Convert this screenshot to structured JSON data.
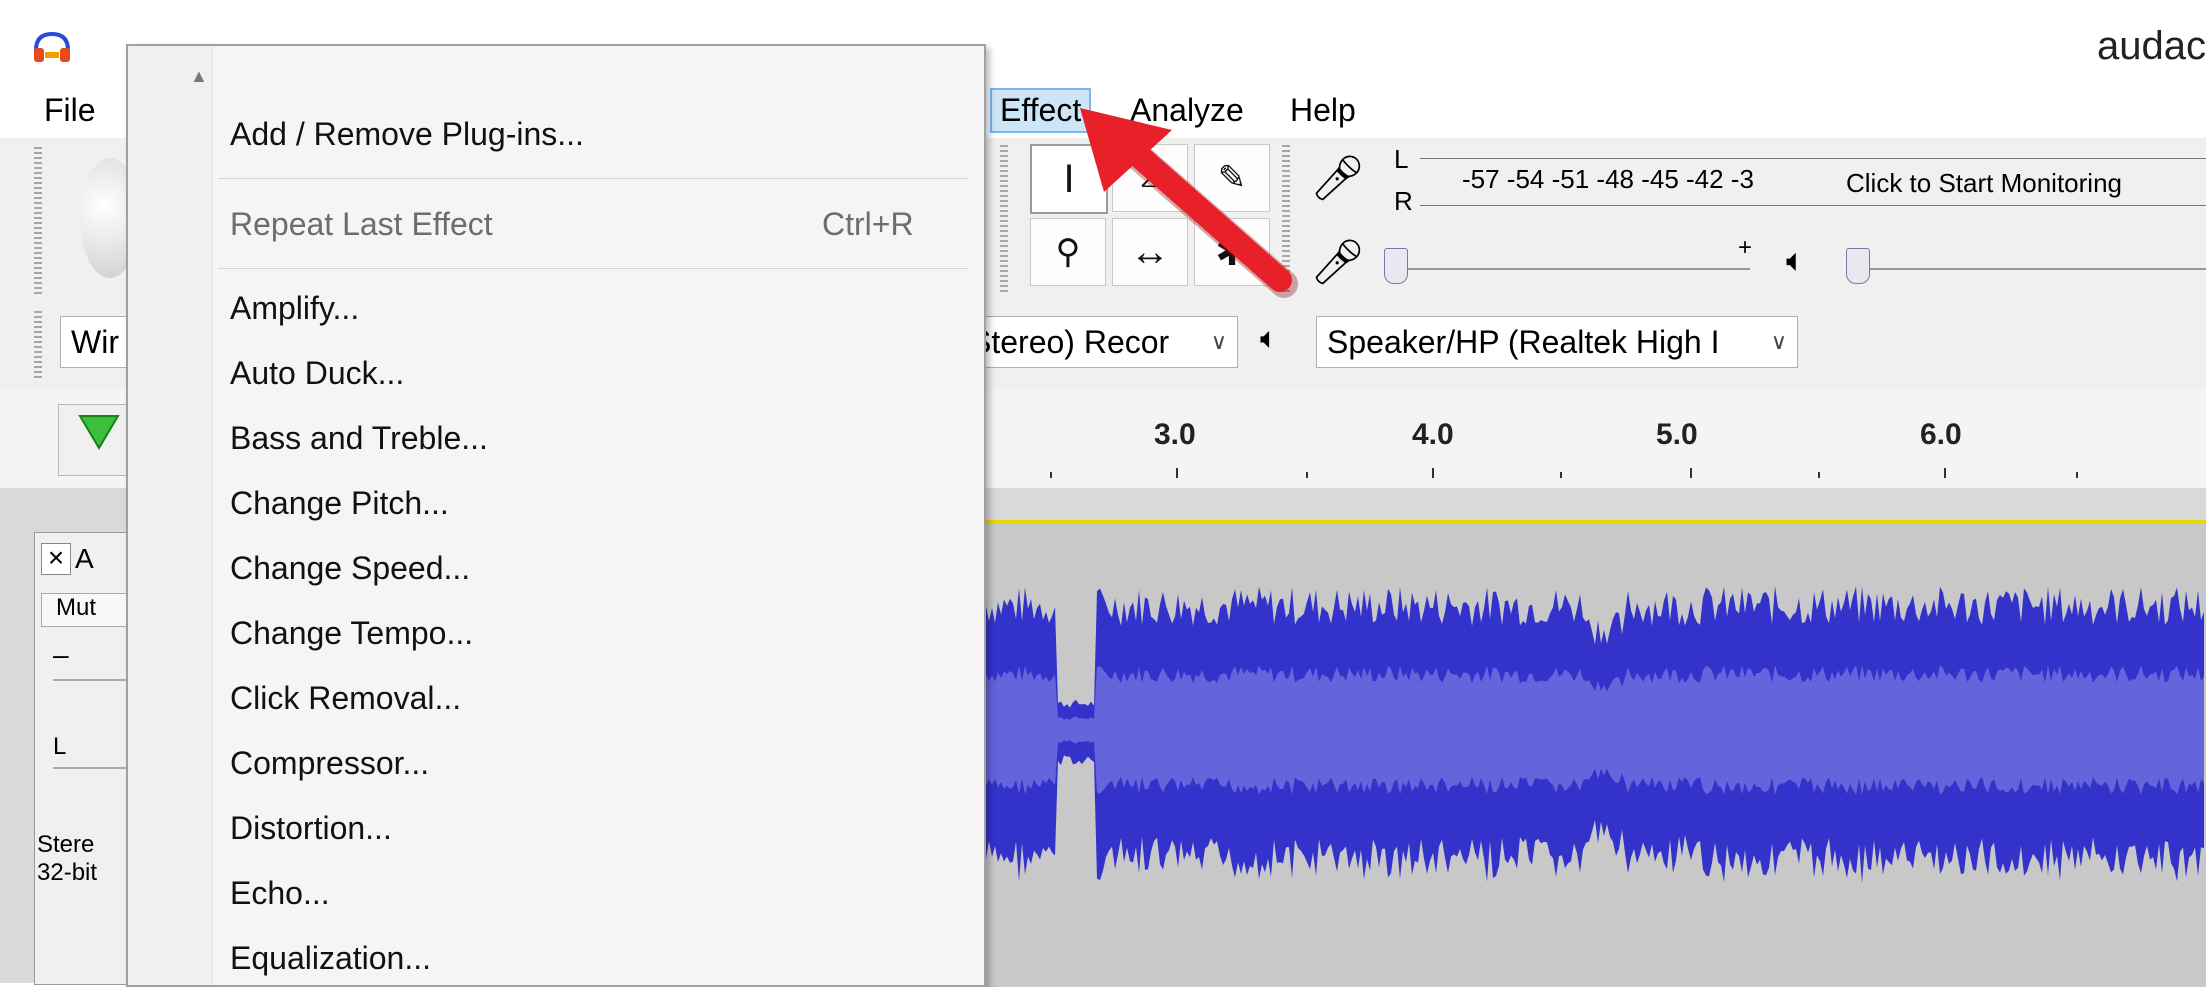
{
  "window": {
    "title": "audac"
  },
  "menubar": {
    "items": [
      "File",
      "Effect",
      "Analyze",
      "Help"
    ]
  },
  "meter": {
    "l_label": "L",
    "r_label": "R",
    "ticks": "-57 -54 -51 -48 -45 -42 -3",
    "monitor_text": "Click to Start Monitoring",
    "plus": "+"
  },
  "devices": {
    "host_partial": "Wir",
    "recording": "Stereo) Recor",
    "playback": "Speaker/HP (Realtek High I"
  },
  "ruler": {
    "labels": [
      "3.0",
      "4.0",
      "5.0",
      "6.0"
    ]
  },
  "track_panel": {
    "close": "×",
    "name_partial": "A",
    "mute_partial": "Mut",
    "minus": "–",
    "pan_l": "L",
    "info_line1": "Stere",
    "info_line2": "32-bit"
  },
  "effect_menu": {
    "add_remove": "Add / Remove Plug-ins...",
    "repeat_last": "Repeat Last Effect",
    "repeat_shortcut": "Ctrl+R",
    "effects": [
      "Amplify...",
      "Auto Duck...",
      "Bass and Treble...",
      "Change Pitch...",
      "Change Speed...",
      "Change Tempo...",
      "Click Removal...",
      "Compressor...",
      "Distortion...",
      "Echo...",
      "Equalization..."
    ]
  },
  "colors": {
    "waveform": "#3333cc",
    "waveform_rms": "#6464dc",
    "arrow": "#e8202a",
    "menu_highlight": "#cde6f7"
  }
}
